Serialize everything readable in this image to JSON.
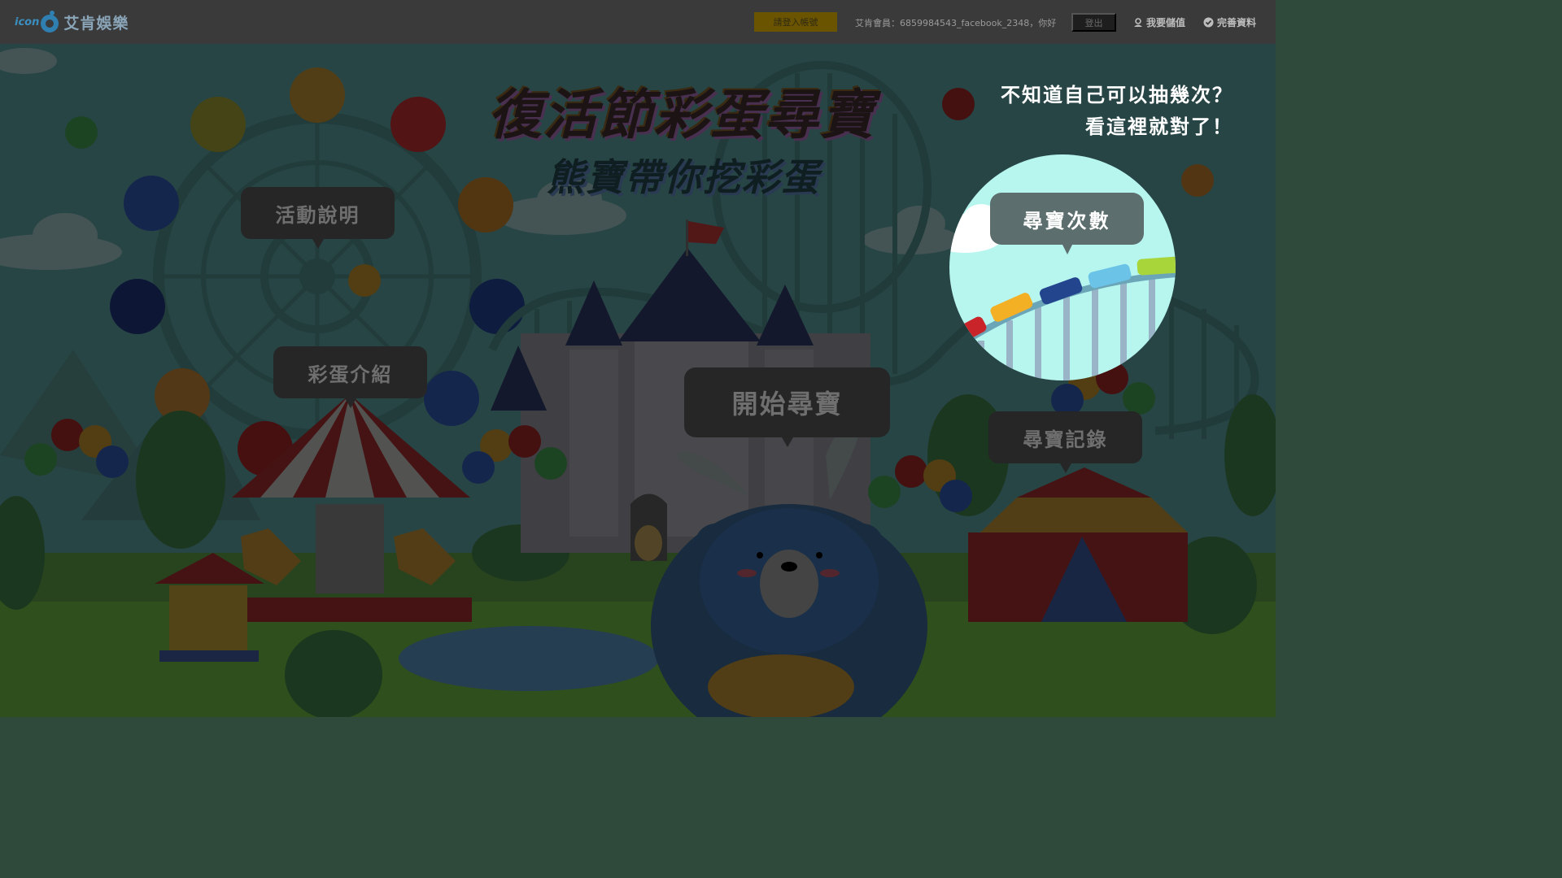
{
  "header": {
    "logo_prefix": "icon",
    "logo_name": "艾肯娛樂",
    "login_button": "請登入帳號",
    "member_text": "艾肯會員：6859984543_facebook_2348，你好",
    "logout_button": "登出",
    "deposit_link": "我要儲值",
    "profile_link": "完善資料"
  },
  "main": {
    "title": "復活節彩蛋尋寶",
    "subtitle": "熊寶帶你挖彩蛋",
    "hint_line1": "不知道自己可以抽幾次？",
    "hint_line2": "看這裡就對了！",
    "menu": {
      "intro": "活動說明",
      "eggs": "彩蛋介紹",
      "start": "開始尋寶",
      "count": "尋寶次數",
      "records": "尋寶記錄"
    }
  },
  "colors": {
    "overlay": "#000000",
    "accent_yellow": "#f5c400",
    "highlight_circle": "#b7f5ef",
    "bubble": "#5d6e6e"
  },
  "icons": [
    "user-icon",
    "check-circle-icon",
    "logo-egg-icon"
  ]
}
